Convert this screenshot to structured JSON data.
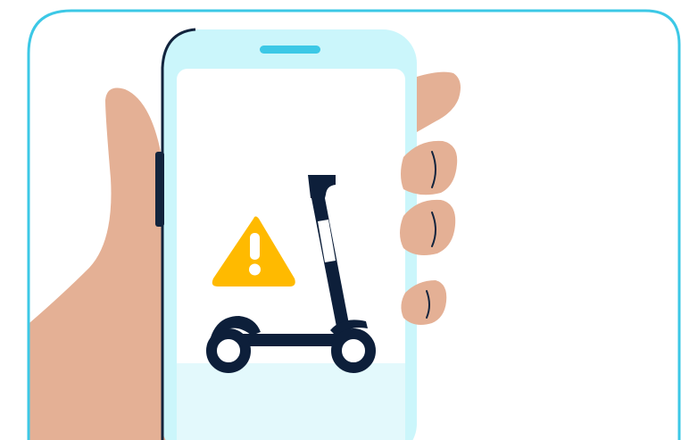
{
  "illustration": {
    "subject": "hand-holding-phone-scooter-warning",
    "icons": [
      "warning-icon",
      "scooter-icon"
    ],
    "colors": {
      "frame_border": "#3cc8e6",
      "phone_body": "#cbf6fb",
      "phone_screen": "#ffffff",
      "screen_bottom": "#e3f9fc",
      "speaker": "#3cc8e6",
      "phone_edge": "#12243d",
      "skin": "#e4b095",
      "nail_line": "#12243d",
      "warning": "#ffba00",
      "warning_mark": "#ffffff",
      "scooter": "#0d1f3a"
    }
  }
}
